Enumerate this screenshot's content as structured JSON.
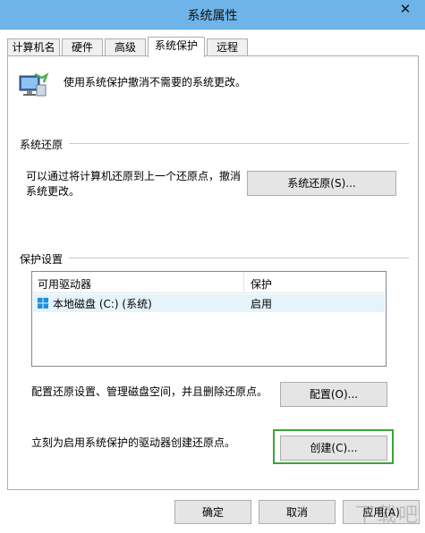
{
  "window": {
    "title": "系统属性",
    "close_glyph": "✕"
  },
  "tabs": [
    {
      "label": "计算机名"
    },
    {
      "label": "硬件"
    },
    {
      "label": "高级"
    },
    {
      "label": "系统保护",
      "active": true
    },
    {
      "label": "远程"
    }
  ],
  "intro": {
    "text": "使用系统保护撤消不需要的系统更改。",
    "icon": "system-protection-icon"
  },
  "restore": {
    "section_label": "系统还原",
    "description_line1": "可以通过将计算机还原到上一个还原点，撤消",
    "description_line2": "系统更改。",
    "button_label": "系统还原(S)..."
  },
  "protection": {
    "section_label": "保护设置",
    "columns": [
      "可用驱动器",
      "保护"
    ],
    "rows": [
      {
        "drive": "本地磁盘 (C:) (系统)",
        "status": "启用",
        "icon": "windows-drive-icon"
      }
    ],
    "configure_text": "配置还原设置、管理磁盘空间，并且删除还原点。",
    "configure_button": "配置(O)...",
    "create_text": "立刻为启用系统保护的驱动器创建还原点。",
    "create_button": "创建(C)..."
  },
  "footer": {
    "ok": "确定",
    "cancel": "取消",
    "apply": "应用(A)"
  },
  "watermark": "下载吧",
  "colors": {
    "titlebar": "#6fb4e8",
    "highlight": "#3aa537",
    "selected_row": "#e5f3fb"
  }
}
